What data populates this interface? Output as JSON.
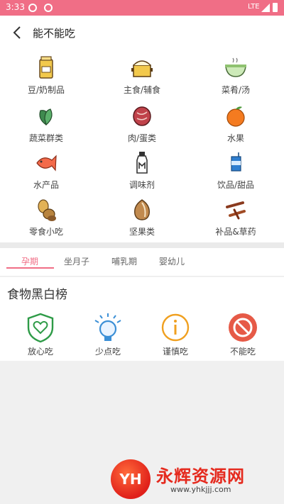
{
  "status": {
    "time": "3:33",
    "network": "LTE"
  },
  "header": {
    "title": "能不能吃"
  },
  "categories": [
    {
      "label": "豆/奶制品",
      "icon": "milk-box-icon"
    },
    {
      "label": "主食/辅食",
      "icon": "rice-pot-icon"
    },
    {
      "label": "菜肴/汤",
      "icon": "soup-bowl-icon"
    },
    {
      "label": "蔬菜群类",
      "icon": "spinach-icon"
    },
    {
      "label": "肉/蛋类",
      "icon": "steak-icon"
    },
    {
      "label": "水果",
      "icon": "orange-icon"
    },
    {
      "label": "水产品",
      "icon": "fish-icon"
    },
    {
      "label": "调味剂",
      "icon": "bottle-icon"
    },
    {
      "label": "饮品/甜品",
      "icon": "drink-carton-icon"
    },
    {
      "label": "零食小吃",
      "icon": "peanut-icon"
    },
    {
      "label": "坚果类",
      "icon": "almond-icon"
    },
    {
      "label": "补品&草药",
      "icon": "herb-icon"
    }
  ],
  "tabs": [
    {
      "label": "孕期",
      "active": true
    },
    {
      "label": "坐月子",
      "active": false
    },
    {
      "label": "哺乳期",
      "active": false
    },
    {
      "label": "婴幼儿",
      "active": false
    }
  ],
  "ranking": {
    "title": "食物黑白榜",
    "items": [
      {
        "label": "放心吃",
        "color": "#2e9b47",
        "icon": "shield-heart-icon"
      },
      {
        "label": "少点吃",
        "color": "#3b8fd6",
        "icon": "lightbulb-icon"
      },
      {
        "label": "谨慎吃",
        "color": "#f0a020",
        "icon": "info-circle-icon"
      },
      {
        "label": "不能吃",
        "color": "#e65a47",
        "icon": "forbidden-icon"
      }
    ]
  },
  "colors": {
    "accent": "#f06e86"
  },
  "watermark": {
    "logo": "YH",
    "name": "永辉资源网",
    "url": "www.yhkjjj.com"
  }
}
